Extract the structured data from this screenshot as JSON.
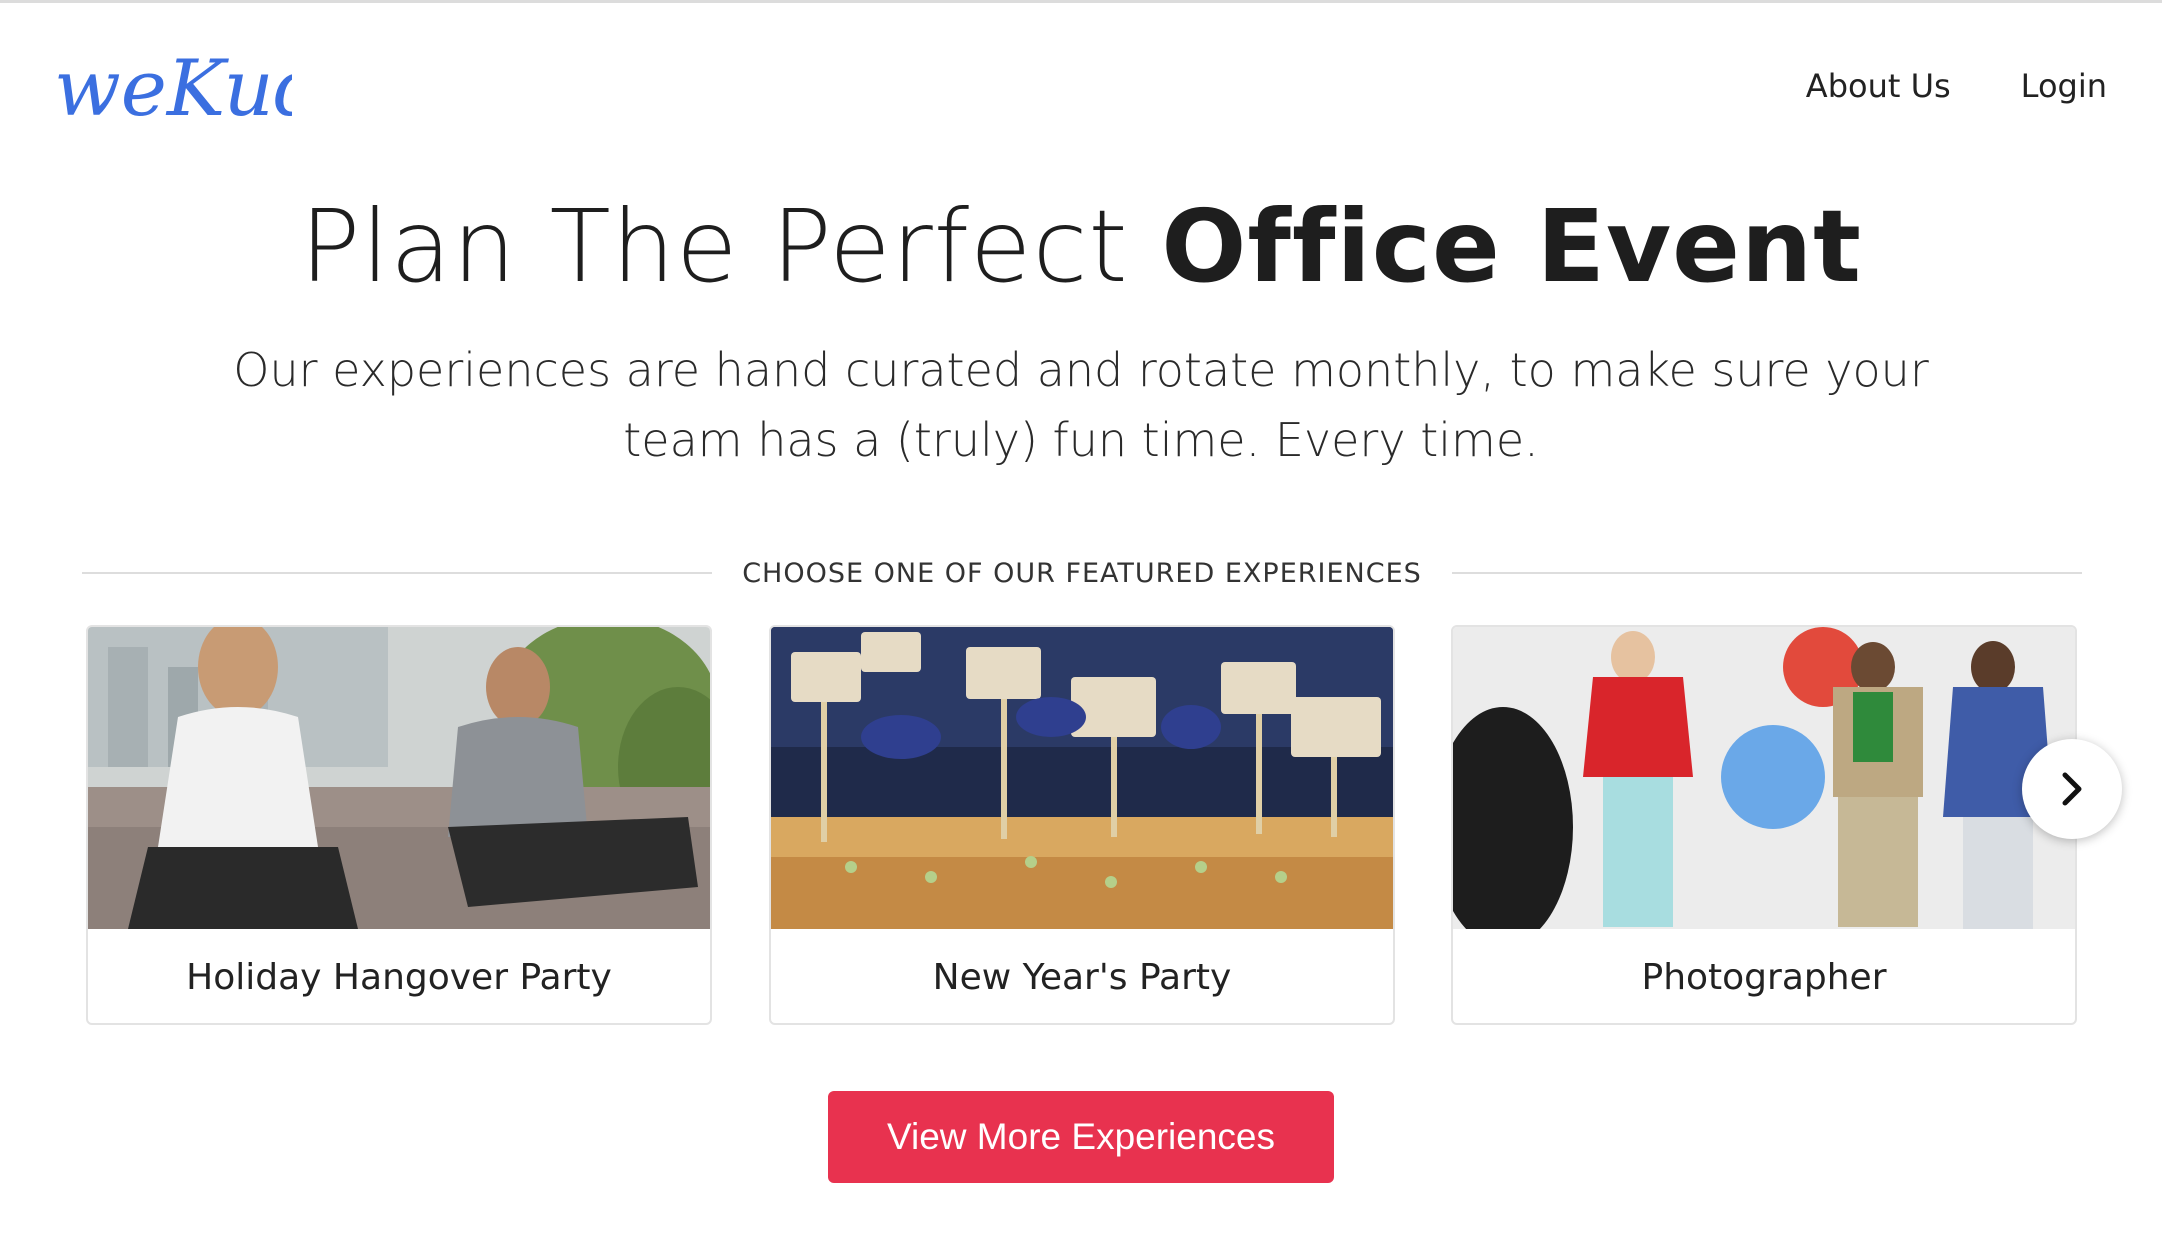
{
  "brand": {
    "logo_text": "weKudo",
    "logo_color": "#3b6fe0"
  },
  "nav": {
    "about": "About Us",
    "login": "Login"
  },
  "hero": {
    "title_regular": "Plan The Perfect ",
    "title_bold": "Office Event",
    "subtitle": "Our experiences are hand curated and rotate monthly, to make sure your team has a (truly) fun time. Every time."
  },
  "featured": {
    "section_label": "CHOOSE ONE OF OUR FEATURED EXPERIENCES",
    "cards": [
      {
        "label": "Holiday Hangover Party"
      },
      {
        "label": "New Year's Party"
      },
      {
        "label": "Photographer"
      }
    ],
    "next_icon": "chevron-right-icon"
  },
  "cta": {
    "label": "View More Experiences",
    "color": "#e8324f"
  }
}
